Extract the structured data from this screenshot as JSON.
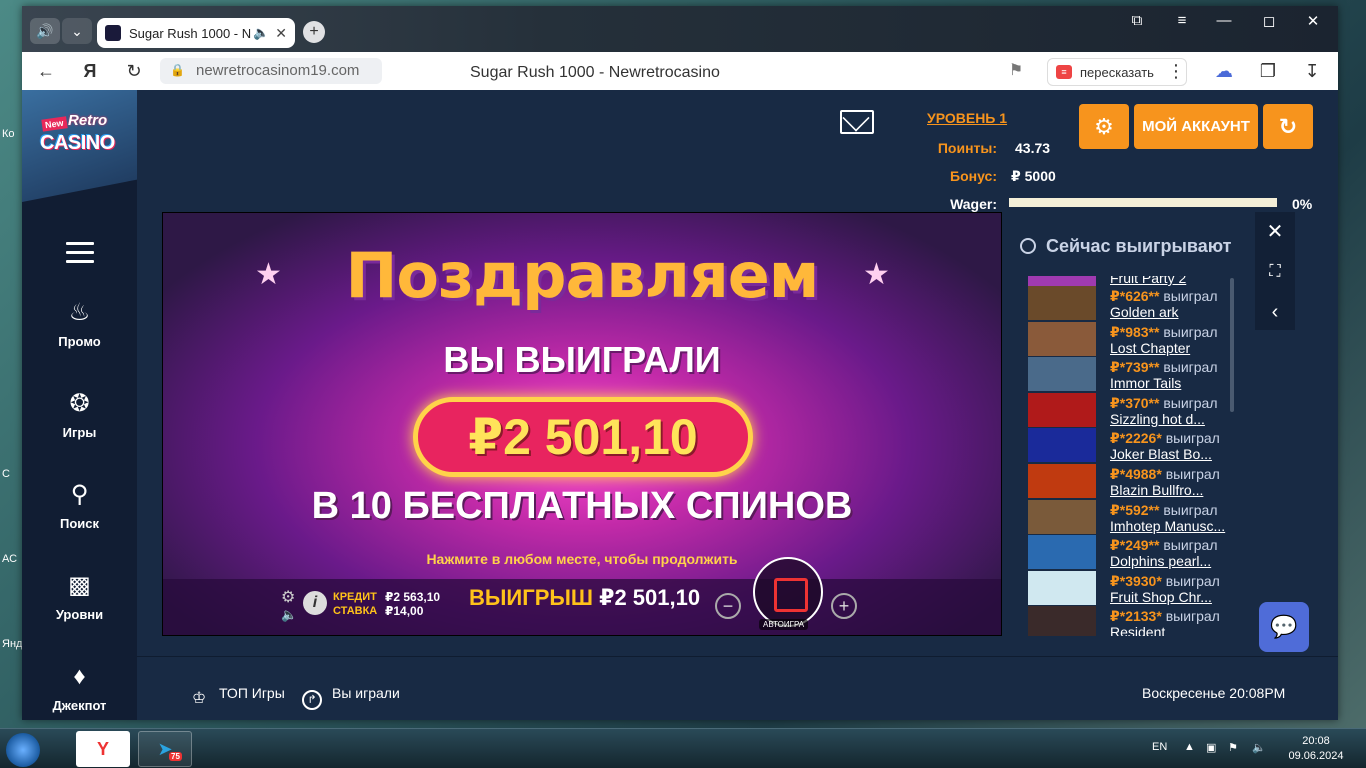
{
  "browser": {
    "tab_title": "Sugar Rush 1000 - N",
    "url": "newretrocasinom19.com",
    "page_title": "Sugar Rush 1000 - Newretrocasino",
    "retell_label": "пересказать"
  },
  "logo": {
    "new": "New",
    "retro": "Retro",
    "casino": "CASINO"
  },
  "sidebar": {
    "items": [
      {
        "label": "Промо",
        "icon": "fire-icon"
      },
      {
        "label": "Игры",
        "icon": "chip-icon"
      },
      {
        "label": "Поиск",
        "icon": "search-icon"
      },
      {
        "label": "Уровни",
        "icon": "chest-icon"
      },
      {
        "label": "Джекпот",
        "icon": "jackpot-icon"
      }
    ]
  },
  "header": {
    "level": "УРОВЕНЬ 1",
    "points_label": "Поинты:",
    "points_value": "43.73",
    "bonus_label": "Бонус:",
    "bonus_value": "₽ 5000",
    "wager_label": "Wager:",
    "wager_value": "0%",
    "wager_progress": 0,
    "account_button": "МОЙ АККАУНТ"
  },
  "game": {
    "congrats": "Поздравляем",
    "won": "ВЫ ВЫИГРАЛИ",
    "amount": "₽2 501,10",
    "spins": "В 10 БЕСПЛАТНЫХ СПИНОВ",
    "press": "Нажмите в любом месте, чтобы продолжить",
    "credit_label": "КРЕДИТ",
    "credit_value": "₽2 563,10",
    "bet_label": "СТАВКА",
    "bet_value": "₽14,00",
    "win_label": "ВЫИГРЫШ",
    "win_value": "₽2 501,10",
    "autoplay": "АВТОИГРА"
  },
  "winners": {
    "title": "Сейчас выигрывают",
    "won_word": "выиграл",
    "top_game": "Fruit Party 2",
    "rows": [
      {
        "user": "₽*626**",
        "game": "Golden ark",
        "color": "#6a4a2a"
      },
      {
        "user": "₽*983**",
        "game": "Lost Chapter",
        "color": "#8a5a3a"
      },
      {
        "user": "₽*739**",
        "game": "Immor Tails",
        "color": "#4a6a8a"
      },
      {
        "user": "₽*370**",
        "game": "Sizzling hot d...",
        "color": "#b01a1a"
      },
      {
        "user": "₽*2226*",
        "game": "Joker Blast Bo...",
        "color": "#1a2a9a"
      },
      {
        "user": "₽*4988*",
        "game": "Blazin Bullfro...",
        "color": "#c03a10"
      },
      {
        "user": "₽*592**",
        "game": "Imhotep Manusc...",
        "color": "#7a5a3a"
      },
      {
        "user": "₽*249**",
        "game": "Dolphins pearl...",
        "color": "#2a6ab0"
      },
      {
        "user": "₽*3930*",
        "game": "Fruit Shop Chr...",
        "color": "#d0e8f0"
      },
      {
        "user": "₽*2133*",
        "game": "Resident",
        "color": "#3a2a2a"
      }
    ]
  },
  "bottom": {
    "top_games": "ТОП Игры",
    "played": "Вы играли",
    "datetime": "Воскресенье 20:08PM"
  },
  "taskbar": {
    "lang": "EN",
    "time": "20:08",
    "date": "09.06.2024",
    "telegram_badge": "75"
  },
  "desktop_labels": [
    "Ко",
    "С",
    "АС",
    "Янд"
  ]
}
